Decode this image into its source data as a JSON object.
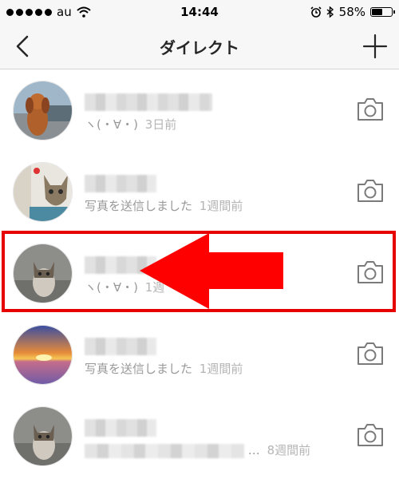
{
  "status_bar": {
    "carrier": "au",
    "time": "14:44",
    "battery": "58%",
    "battery_level": 0.58
  },
  "header": {
    "title": "ダイレクト"
  },
  "threads": [
    {
      "preview": "ヽ(・∀・)",
      "time": "3日前",
      "avatar": "dog"
    },
    {
      "preview": "写真を送信しました",
      "time": "1週間前",
      "avatar": "cat-window"
    },
    {
      "preview": "ヽ(・∀・)",
      "time": "1週",
      "avatar": "kitten"
    },
    {
      "preview": "写真を送信しました",
      "time": "1週間前",
      "avatar": "sunset"
    },
    {
      "preview": "…",
      "time": "8週間前",
      "avatar": "kitten"
    }
  ],
  "annotation": {
    "highlight_color": "#e60000",
    "arrow_color": "#ff0000"
  },
  "icons": [
    "back-chevron-icon",
    "plus-icon",
    "camera-icon",
    "wifi-icon",
    "alarm-icon",
    "bluetooth-icon",
    "battery-icon"
  ]
}
